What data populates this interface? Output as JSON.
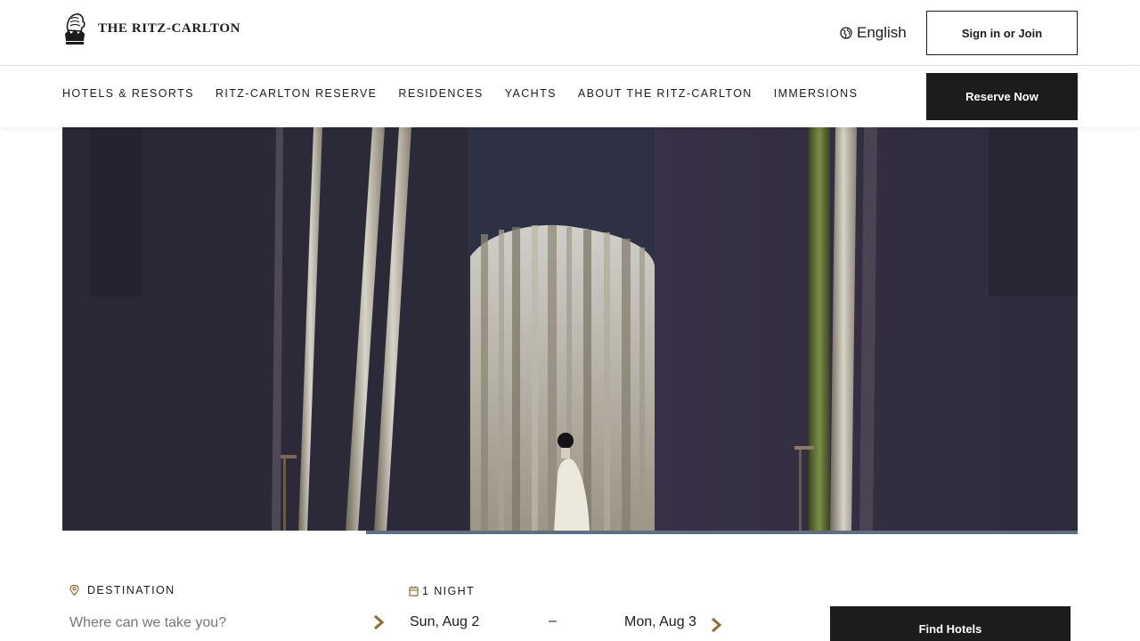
{
  "brand": {
    "name": "THE RITZ-CARLTON",
    "logo_icon": "lion-crown-icon"
  },
  "header": {
    "language": "English",
    "language_icon": "globe-icon",
    "sign_in_label": "Sign in or Join"
  },
  "nav": {
    "items": [
      {
        "label": "HOTELS & RESORTS"
      },
      {
        "label": "RITZ-CARLTON RESERVE"
      },
      {
        "label": "RESIDENCES"
      },
      {
        "label": "YACHTS"
      },
      {
        "label": "ABOUT THE RITZ-CARLTON"
      },
      {
        "label": "IMMERSIONS"
      }
    ],
    "reserve_label": "Reserve Now"
  },
  "hero": {
    "media_progress": 0.3
  },
  "booking": {
    "destination": {
      "label": "DESTINATION",
      "placeholder": "Where can we take you?",
      "value": "",
      "icon": "map-pin-icon"
    },
    "dates": {
      "nights_label": "1 NIGHT",
      "icon": "calendar-icon",
      "check_in": "Sun, Aug 2",
      "separator": "–",
      "check_out": "Mon, Aug 3"
    },
    "find_label": "Find Hotels"
  },
  "colors": {
    "primary_dark": "#1c1c1c",
    "accent_gold": "#8c6b2f",
    "progress_bar": "#5e6f84",
    "hero_wall": "#2d2a3c"
  }
}
